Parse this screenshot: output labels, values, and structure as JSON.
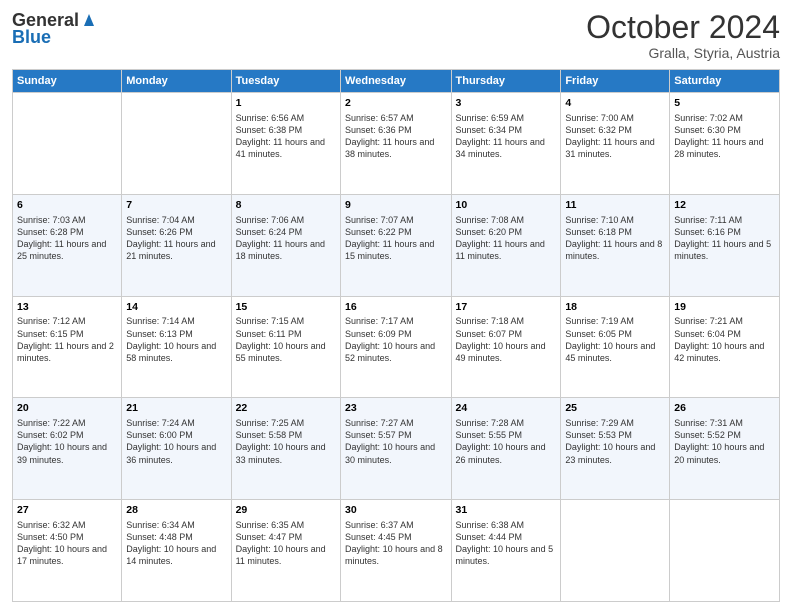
{
  "header": {
    "logo_general": "General",
    "logo_blue": "Blue",
    "month_title": "October 2024",
    "location": "Gralla, Styria, Austria"
  },
  "days_of_week": [
    "Sunday",
    "Monday",
    "Tuesday",
    "Wednesday",
    "Thursday",
    "Friday",
    "Saturday"
  ],
  "weeks": [
    [
      {
        "day": "",
        "info": ""
      },
      {
        "day": "",
        "info": ""
      },
      {
        "day": "1",
        "info": "Sunrise: 6:56 AM\nSunset: 6:38 PM\nDaylight: 11 hours and 41 minutes."
      },
      {
        "day": "2",
        "info": "Sunrise: 6:57 AM\nSunset: 6:36 PM\nDaylight: 11 hours and 38 minutes."
      },
      {
        "day": "3",
        "info": "Sunrise: 6:59 AM\nSunset: 6:34 PM\nDaylight: 11 hours and 34 minutes."
      },
      {
        "day": "4",
        "info": "Sunrise: 7:00 AM\nSunset: 6:32 PM\nDaylight: 11 hours and 31 minutes."
      },
      {
        "day": "5",
        "info": "Sunrise: 7:02 AM\nSunset: 6:30 PM\nDaylight: 11 hours and 28 minutes."
      }
    ],
    [
      {
        "day": "6",
        "info": "Sunrise: 7:03 AM\nSunset: 6:28 PM\nDaylight: 11 hours and 25 minutes."
      },
      {
        "day": "7",
        "info": "Sunrise: 7:04 AM\nSunset: 6:26 PM\nDaylight: 11 hours and 21 minutes."
      },
      {
        "day": "8",
        "info": "Sunrise: 7:06 AM\nSunset: 6:24 PM\nDaylight: 11 hours and 18 minutes."
      },
      {
        "day": "9",
        "info": "Sunrise: 7:07 AM\nSunset: 6:22 PM\nDaylight: 11 hours and 15 minutes."
      },
      {
        "day": "10",
        "info": "Sunrise: 7:08 AM\nSunset: 6:20 PM\nDaylight: 11 hours and 11 minutes."
      },
      {
        "day": "11",
        "info": "Sunrise: 7:10 AM\nSunset: 6:18 PM\nDaylight: 11 hours and 8 minutes."
      },
      {
        "day": "12",
        "info": "Sunrise: 7:11 AM\nSunset: 6:16 PM\nDaylight: 11 hours and 5 minutes."
      }
    ],
    [
      {
        "day": "13",
        "info": "Sunrise: 7:12 AM\nSunset: 6:15 PM\nDaylight: 11 hours and 2 minutes."
      },
      {
        "day": "14",
        "info": "Sunrise: 7:14 AM\nSunset: 6:13 PM\nDaylight: 10 hours and 58 minutes."
      },
      {
        "day": "15",
        "info": "Sunrise: 7:15 AM\nSunset: 6:11 PM\nDaylight: 10 hours and 55 minutes."
      },
      {
        "day": "16",
        "info": "Sunrise: 7:17 AM\nSunset: 6:09 PM\nDaylight: 10 hours and 52 minutes."
      },
      {
        "day": "17",
        "info": "Sunrise: 7:18 AM\nSunset: 6:07 PM\nDaylight: 10 hours and 49 minutes."
      },
      {
        "day": "18",
        "info": "Sunrise: 7:19 AM\nSunset: 6:05 PM\nDaylight: 10 hours and 45 minutes."
      },
      {
        "day": "19",
        "info": "Sunrise: 7:21 AM\nSunset: 6:04 PM\nDaylight: 10 hours and 42 minutes."
      }
    ],
    [
      {
        "day": "20",
        "info": "Sunrise: 7:22 AM\nSunset: 6:02 PM\nDaylight: 10 hours and 39 minutes."
      },
      {
        "day": "21",
        "info": "Sunrise: 7:24 AM\nSunset: 6:00 PM\nDaylight: 10 hours and 36 minutes."
      },
      {
        "day": "22",
        "info": "Sunrise: 7:25 AM\nSunset: 5:58 PM\nDaylight: 10 hours and 33 minutes."
      },
      {
        "day": "23",
        "info": "Sunrise: 7:27 AM\nSunset: 5:57 PM\nDaylight: 10 hours and 30 minutes."
      },
      {
        "day": "24",
        "info": "Sunrise: 7:28 AM\nSunset: 5:55 PM\nDaylight: 10 hours and 26 minutes."
      },
      {
        "day": "25",
        "info": "Sunrise: 7:29 AM\nSunset: 5:53 PM\nDaylight: 10 hours and 23 minutes."
      },
      {
        "day": "26",
        "info": "Sunrise: 7:31 AM\nSunset: 5:52 PM\nDaylight: 10 hours and 20 minutes."
      }
    ],
    [
      {
        "day": "27",
        "info": "Sunrise: 6:32 AM\nSunset: 4:50 PM\nDaylight: 10 hours and 17 minutes."
      },
      {
        "day": "28",
        "info": "Sunrise: 6:34 AM\nSunset: 4:48 PM\nDaylight: 10 hours and 14 minutes."
      },
      {
        "day": "29",
        "info": "Sunrise: 6:35 AM\nSunset: 4:47 PM\nDaylight: 10 hours and 11 minutes."
      },
      {
        "day": "30",
        "info": "Sunrise: 6:37 AM\nSunset: 4:45 PM\nDaylight: 10 hours and 8 minutes."
      },
      {
        "day": "31",
        "info": "Sunrise: 6:38 AM\nSunset: 4:44 PM\nDaylight: 10 hours and 5 minutes."
      },
      {
        "day": "",
        "info": ""
      },
      {
        "day": "",
        "info": ""
      }
    ]
  ]
}
